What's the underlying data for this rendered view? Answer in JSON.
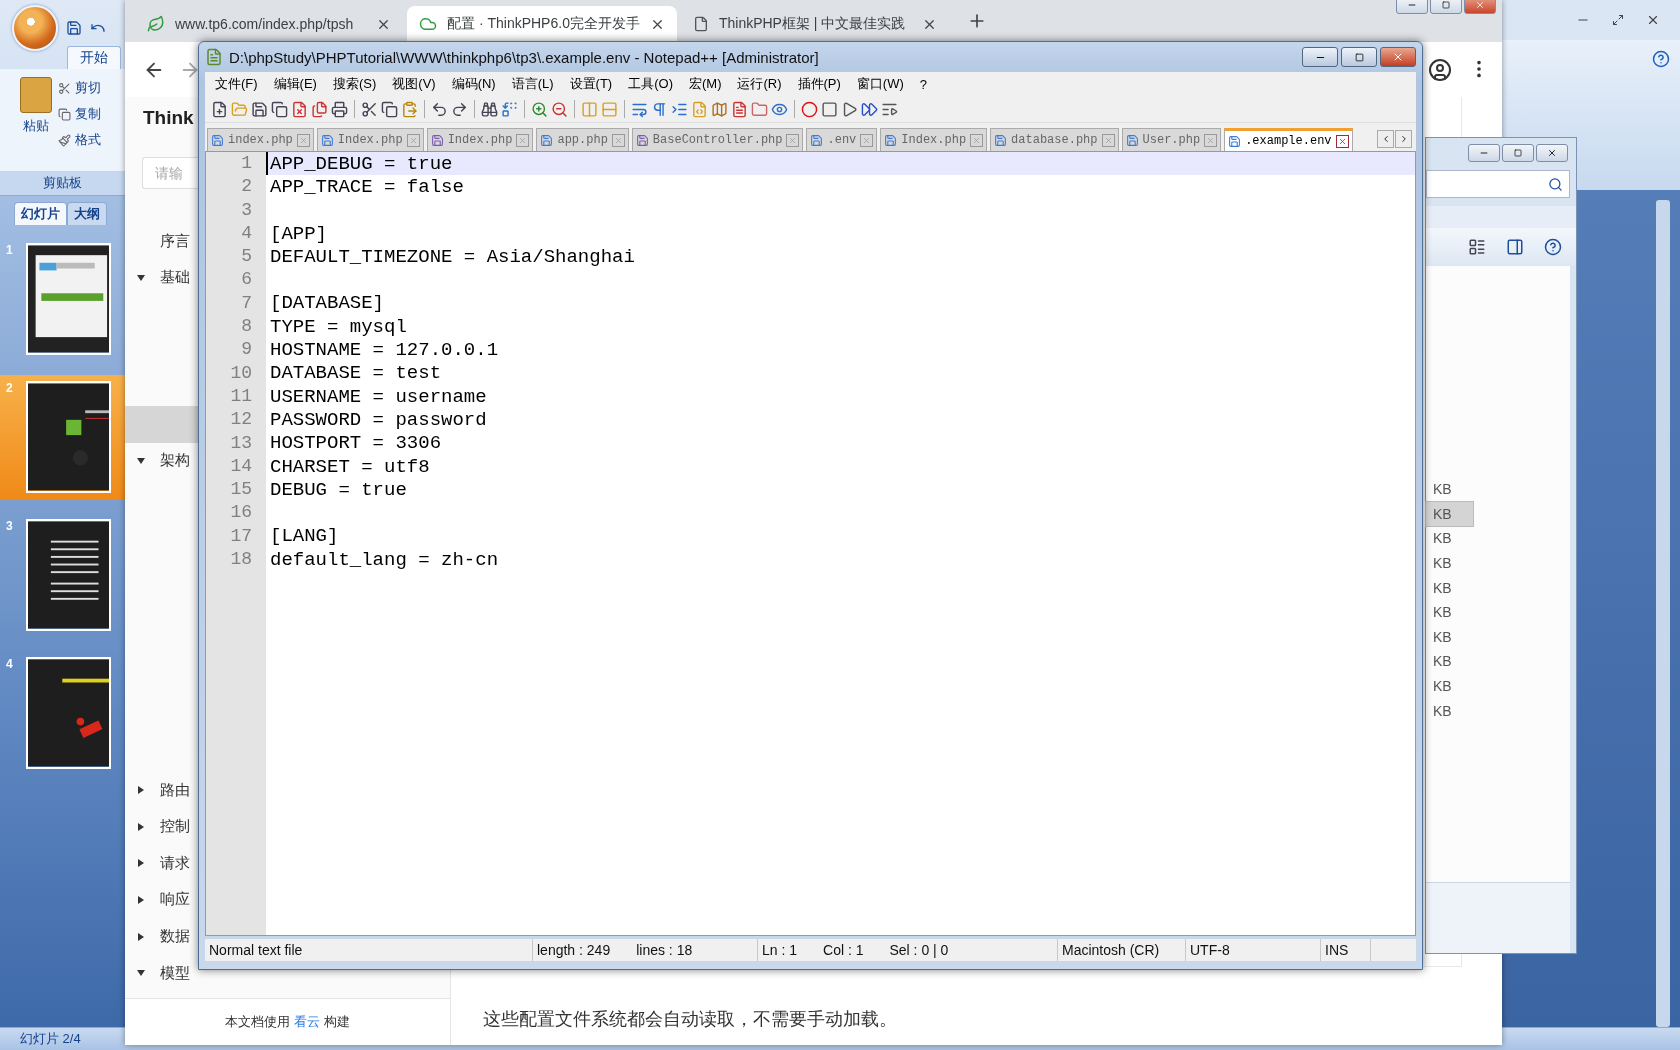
{
  "powerpoint": {
    "ribbon_tab": "开始",
    "paste": "粘贴",
    "clipboard_items": [
      "剪切",
      "复制",
      "格式"
    ],
    "group_label": "剪贴板",
    "pane_tabs": [
      {
        "label": "幻灯片",
        "selected": true
      },
      {
        "label": "大纲",
        "selected": false
      }
    ],
    "slides": [
      {
        "number": "1",
        "selected": false,
        "kind": "light"
      },
      {
        "number": "2",
        "selected": true,
        "kind": "logo"
      },
      {
        "number": "3",
        "selected": false,
        "kind": "list"
      },
      {
        "number": "4",
        "selected": false,
        "kind": "banner"
      }
    ],
    "status": "幻灯片 2/4"
  },
  "browser": {
    "tabs": [
      {
        "title": "www.tp6.com/index.php/tpsh",
        "selected": false,
        "kind": "site"
      },
      {
        "title": "配置 · ThinkPHP6.0完全开发手",
        "selected": true,
        "kind": "cloud"
      },
      {
        "title": "ThinkPHP框架 | 中文最佳实践",
        "selected": false,
        "kind": "page"
      }
    ],
    "site_title": "Think",
    "search": {
      "placeholder": "请输"
    },
    "nav": [
      {
        "label": "序言",
        "selected": false
      },
      {
        "label": "基础",
        "selected": false,
        "expanded": true,
        "children": [
          {
            "selected": false
          },
          {
            "selected": false
          },
          {
            "selected": false
          },
          {
            "selected": true
          }
        ]
      },
      {
        "label": "架构",
        "selected": false,
        "expanded": true,
        "children": [
          {
            "selected": false
          },
          {
            "selected": false
          },
          {
            "selected": false
          },
          {
            "selected": false
          },
          {
            "selected": false
          },
          {
            "selected": false
          },
          {
            "selected": false
          },
          {
            "selected": false
          }
        ]
      },
      {
        "label": "路由",
        "selected": false,
        "expanded": false
      },
      {
        "label": "控制",
        "selected": false,
        "expanded": false
      },
      {
        "label": "请求",
        "selected": false,
        "expanded": false
      },
      {
        "label": "响应",
        "selected": false,
        "expanded": false
      },
      {
        "label": "数据",
        "selected": false,
        "expanded": false
      },
      {
        "label": "模型",
        "selected": false,
        "expanded": true
      }
    ],
    "footer": {
      "before": "本文档使用",
      "link": "看云",
      "after": "构建"
    },
    "content": "这些配置文件系统都会自动读取，不需要手动加载。"
  },
  "explorer": {
    "rows": [
      {
        "size": "KB",
        "selected": false
      },
      {
        "size": "KB",
        "selected": true
      },
      {
        "size": "KB",
        "selected": false
      },
      {
        "size": "KB",
        "selected": false
      },
      {
        "size": "KB",
        "selected": false
      },
      {
        "size": "KB",
        "selected": false
      },
      {
        "size": "KB",
        "selected": false
      },
      {
        "size": "KB",
        "selected": false
      },
      {
        "size": "KB",
        "selected": false
      },
      {
        "size": "KB",
        "selected": false
      }
    ]
  },
  "notepad": {
    "title": "D:\\phpStudy\\PHPTutorial\\WWW\\thinkphp6\\tp3\\.example.env - Notepad++ [Administrator]",
    "menus": [
      "文件(F)",
      "编辑(E)",
      "搜索(S)",
      "视图(V)",
      "编码(N)",
      "语言(L)",
      "设置(T)",
      "工具(O)",
      "宏(M)",
      "运行(R)",
      "插件(P)",
      "窗口(W)",
      "?"
    ],
    "tabs": [
      {
        "label": "index.php",
        "selected": false,
        "kind": "php"
      },
      {
        "label": "Index.php",
        "selected": false,
        "kind": "php"
      },
      {
        "label": "Index.php",
        "selected": false,
        "kind": "model"
      },
      {
        "label": "app.php",
        "selected": false,
        "kind": "php"
      },
      {
        "label": "BaseController.php",
        "selected": false,
        "kind": "model"
      },
      {
        "label": ".env",
        "selected": false,
        "kind": "php"
      },
      {
        "label": "Index.php",
        "selected": false,
        "kind": "php"
      },
      {
        "label": "database.php",
        "selected": false,
        "kind": "php"
      },
      {
        "label": "User.php",
        "selected": false,
        "kind": "php"
      },
      {
        "label": ".example.env",
        "selected": true,
        "kind": "env"
      }
    ],
    "lines": [
      {
        "number": "1",
        "text": "APP_DEBUG = true",
        "current": true
      },
      {
        "number": "2",
        "text": "APP_TRACE = false",
        "current": false
      },
      {
        "number": "3",
        "current": false
      },
      {
        "number": "4",
        "text": "[APP]",
        "current": false
      },
      {
        "number": "5",
        "text": "DEFAULT_TIMEZONE = Asia/Shanghai",
        "current": false
      },
      {
        "number": "6",
        "current": false
      },
      {
        "number": "7",
        "text": "[DATABASE]",
        "current": false
      },
      {
        "number": "8",
        "text": "TYPE = mysql",
        "current": false
      },
      {
        "number": "9",
        "text": "HOSTNAME = 127.0.0.1",
        "current": false
      },
      {
        "number": "10",
        "text": "DATABASE = test",
        "current": false
      },
      {
        "number": "11",
        "text": "USERNAME = username",
        "current": false
      },
      {
        "number": "12",
        "text": "PASSWORD = password",
        "current": false
      },
      {
        "number": "13",
        "text": "HOSTPORT = 3306",
        "current": false
      },
      {
        "number": "14",
        "text": "CHARSET = utf8",
        "current": false
      },
      {
        "number": "15",
        "text": "DEBUG = true",
        "current": false
      },
      {
        "number": "16",
        "current": false
      },
      {
        "number": "17",
        "text": "[LANG]",
        "current": false
      },
      {
        "number": "18",
        "text": "default_lang = zh-cn",
        "current": false
      }
    ],
    "status_bar": {
      "file_type": "Normal text file",
      "length": "length : 249",
      "lines": "lines : 18",
      "ln": "Ln : 1",
      "col": "Col : 1",
      "sel": "Sel : 0 | 0",
      "eol": "Macintosh (CR)",
      "encoding": "UTF-8",
      "mode": "INS"
    }
  }
}
